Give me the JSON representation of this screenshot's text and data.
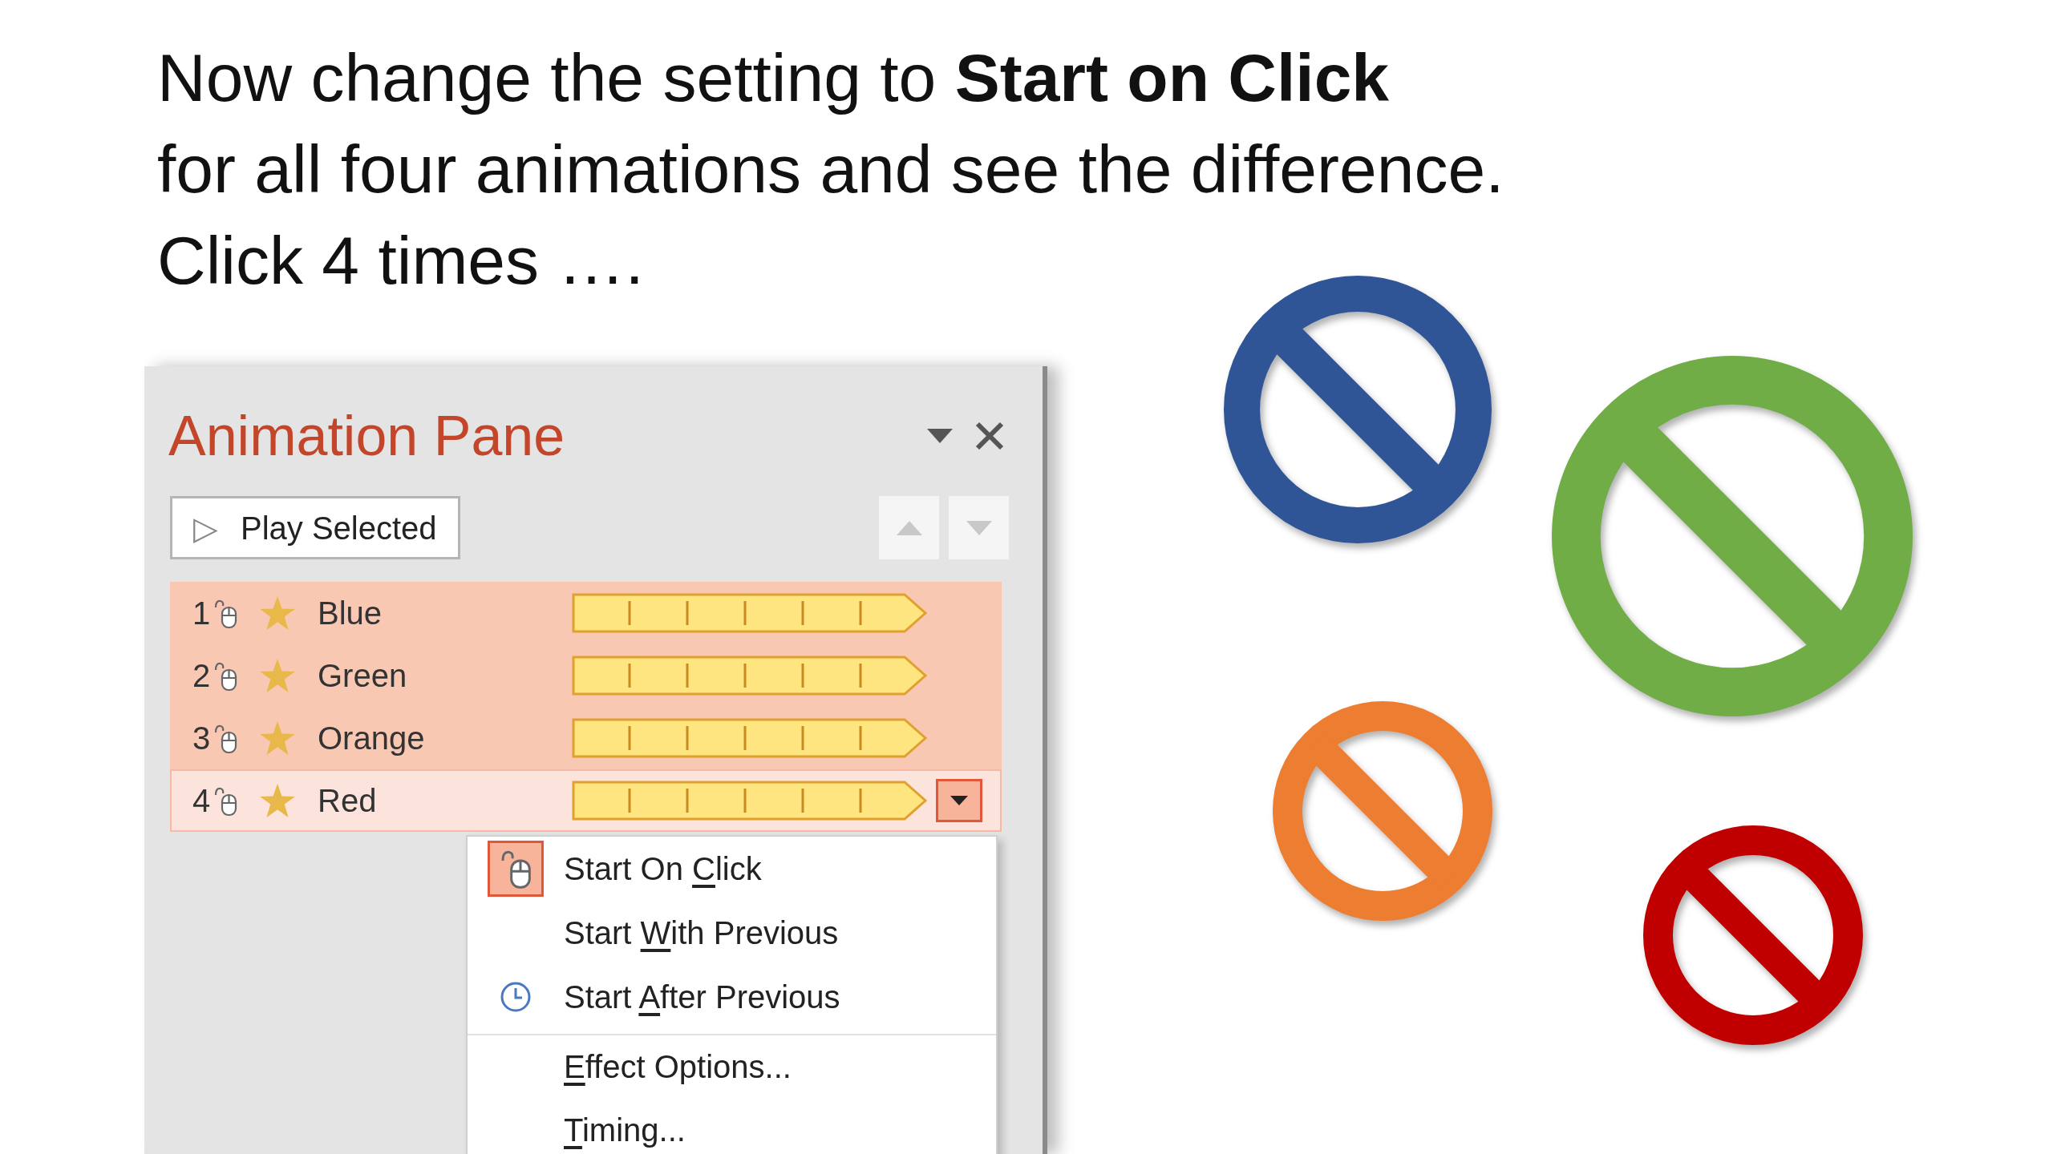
{
  "heading": {
    "lines": [
      "Now change the setting to **Start on Click**",
      "for all four animations and see the difference.",
      "Click 4 times …."
    ]
  },
  "pane": {
    "title": "Animation Pane",
    "play_button": {
      "icon": "▷",
      "label": "Play Selected"
    },
    "animations": [
      {
        "number": "1",
        "name": "Blue",
        "selected": true,
        "hovered": false
      },
      {
        "number": "2",
        "name": "Green",
        "selected": true,
        "hovered": false
      },
      {
        "number": "3",
        "name": "Orange",
        "selected": true,
        "hovered": false
      },
      {
        "number": "4",
        "name": "Red",
        "selected": true,
        "hovered": true
      }
    ],
    "menu": [
      {
        "lead": "Start On ",
        "key": "C",
        "rest": "lick",
        "kind": "mouse",
        "checked": true,
        "separator_before": false
      },
      {
        "lead": "Start ",
        "key": "W",
        "rest": "ith Previous",
        "kind": "plain",
        "checked": false,
        "separator_before": false
      },
      {
        "lead": "Start ",
        "key": "A",
        "rest": "fter Previous",
        "kind": "clock",
        "checked": false,
        "separator_before": false
      },
      {
        "key": "E",
        "rest": "ffect Options...",
        "kind": "plain",
        "checked": false,
        "separator_before": true
      },
      {
        "key": "T",
        "rest": "iming...",
        "kind": "plain",
        "checked": false,
        "separator_before": false
      }
    ]
  },
  "shapes": [
    {
      "color": "#2f5597"
    },
    {
      "color": "#70ad47"
    },
    {
      "color": "#ed7d31"
    },
    {
      "color": "#c00000"
    }
  ]
}
